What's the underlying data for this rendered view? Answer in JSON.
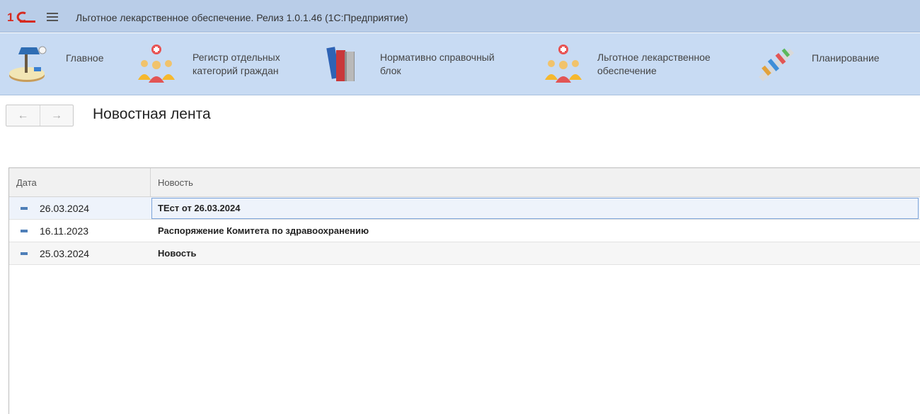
{
  "window": {
    "title": "Льготное лекарственное обеспечение. Релиз 1.0.1.46  (1С:Предприятие)"
  },
  "sections": [
    {
      "label_line1": "Главное",
      "label_line2": "",
      "icon": "desk-lamp-icon"
    },
    {
      "label_line1": "Регистр отдельных",
      "label_line2": "категорий граждан",
      "icon": "people-medical-icon"
    },
    {
      "label_line1": "Нормативно справочный",
      "label_line2": "блок",
      "icon": "books-icon"
    },
    {
      "label_line1": "Льготное лекарственное",
      "label_line2": "обеспечение",
      "icon": "people-medical-icon"
    },
    {
      "label_line1": "Планирование",
      "label_line2": "",
      "icon": "chart-icon"
    }
  ],
  "nav": {
    "back": "←",
    "forward": "→"
  },
  "page": {
    "title": "Новостная лента"
  },
  "table": {
    "columns": [
      "Дата",
      "Новость"
    ],
    "rows": [
      {
        "date": "26.03.2024",
        "news": "ТЕст от 26.03.2024"
      },
      {
        "date": "16.11.2023",
        "news": "Распоряжение Комитета по здравоохранению"
      },
      {
        "date": "25.03.2024",
        "news": "Новость"
      }
    ]
  },
  "colors": {
    "titlebar": "#b9cde8",
    "sections_panel": "#c8dbf3",
    "row_marker": "#4f7fb8",
    "selection_border": "#7aa3d9"
  }
}
